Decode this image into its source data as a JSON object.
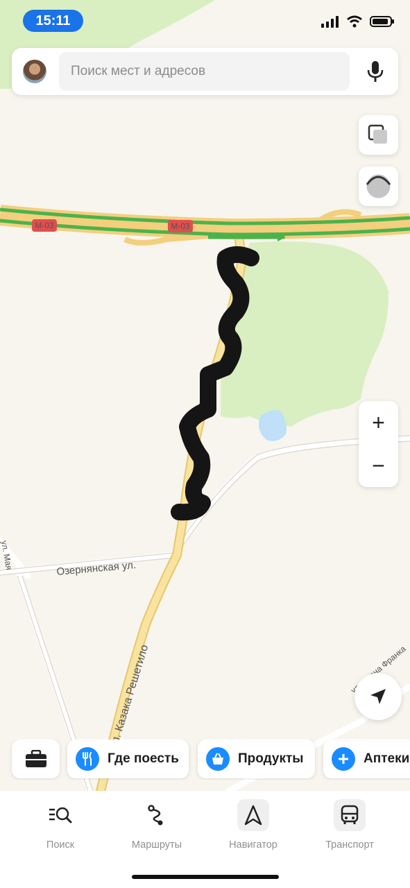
{
  "status": {
    "time": "15:11"
  },
  "search": {
    "placeholder": "Поиск мест и адресов"
  },
  "map": {
    "highway_shield_1": "M-03",
    "highway_shield_2": "M-03",
    "street_1": "Озернянская ул.",
    "street_2": "ул. Казака Решетило",
    "street_3": "ул. Ивана Франка",
    "street_4": "ул. Мая"
  },
  "zoom": {
    "in": "+",
    "out": "−"
  },
  "chips": [
    {
      "label": "",
      "icon": "briefcase-icon"
    },
    {
      "label": "Где поесть",
      "icon": "fork-knife-icon"
    },
    {
      "label": "Продукты",
      "icon": "basket-icon"
    },
    {
      "label": "Аптеки",
      "icon": "plus-icon"
    }
  ],
  "tabs": [
    {
      "label": "Поиск",
      "icon": "search-list-icon"
    },
    {
      "label": "Маршруты",
      "icon": "route-icon"
    },
    {
      "label": "Навигатор",
      "icon": "navigator-arrow-icon"
    },
    {
      "label": "Транспорт",
      "icon": "bus-icon"
    }
  ],
  "colors": {
    "accent": "#1a8cff",
    "traffic_green": "#4bb34b",
    "road_yellow": "#f8e3a0",
    "park_green": "#d9efc2",
    "water": "#bfe0f7"
  }
}
